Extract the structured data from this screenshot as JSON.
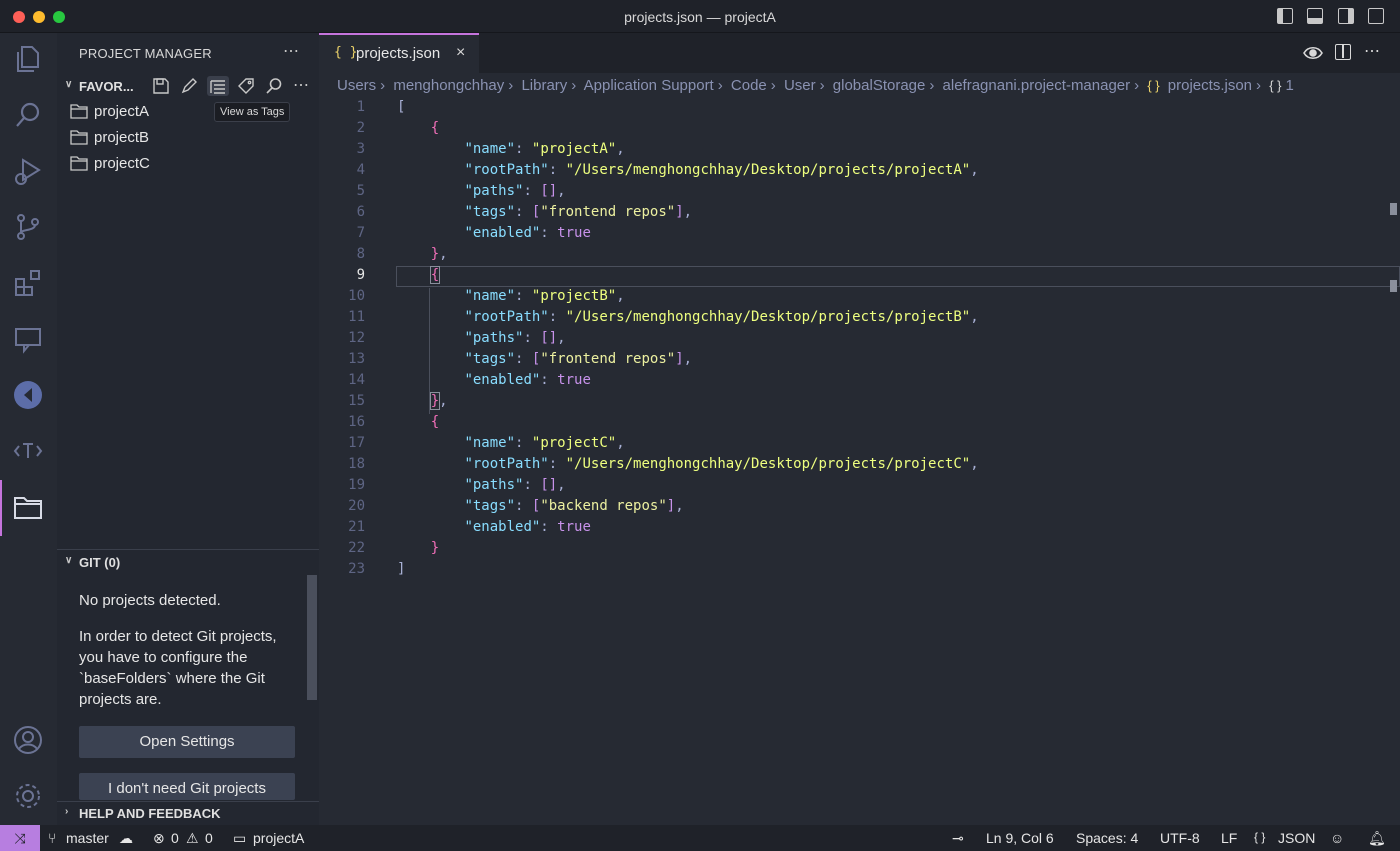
{
  "window": {
    "title": "projects.json — projectA"
  },
  "sidebar": {
    "title": "PROJECT MANAGER",
    "favorites_label": "FAVOR...",
    "tooltip": "View as Tags",
    "projects": [
      {
        "name": "projectA"
      },
      {
        "name": "projectB"
      },
      {
        "name": "projectC"
      }
    ],
    "git_label": "GIT (0)",
    "git_message_1": "No projects detected.",
    "git_message_2": "In order to detect Git projects, you have to configure the `baseFolders` where the Git projects are.",
    "open_settings": "Open Settings",
    "no_git": "I don't need Git projects",
    "help_label": "HELP AND FEEDBACK"
  },
  "editor": {
    "tab_label": "projects.json",
    "tab_icon": "{ }",
    "breadcrumb": [
      "Users",
      "menghongchhay",
      "Library",
      "Application Support",
      "Code",
      "User",
      "globalStorage",
      "alefragnani.project-manager",
      "projects.json",
      "1"
    ],
    "line_numbers": [
      "1",
      "2",
      "3",
      "4",
      "5",
      "6",
      "7",
      "8",
      "9",
      "10",
      "11",
      "12",
      "13",
      "14",
      "15",
      "16",
      "17",
      "18",
      "19",
      "20",
      "21",
      "22",
      "23"
    ],
    "projects": [
      {
        "name": "projectA",
        "rootPath": "/Users/menghongchhay/Desktop/projects/projectA",
        "tag": "frontend repos",
        "enabled": "true"
      },
      {
        "name": "projectB",
        "rootPath": "/Users/menghongchhay/Desktop/projects/projectB",
        "tag": "frontend repos",
        "enabled": "true"
      },
      {
        "name": "projectC",
        "rootPath": "/Users/menghongchhay/Desktop/projects/projectC",
        "tag": "backend repos",
        "enabled": "true"
      }
    ],
    "keys": {
      "name": "\"name\"",
      "rootPath": "\"rootPath\"",
      "paths": "\"paths\"",
      "tags": "\"tags\"",
      "enabled": "\"enabled\""
    }
  },
  "statusbar": {
    "branch": "master",
    "errors": "0",
    "warnings": "0",
    "project": "projectA",
    "cursor": "Ln 9, Col 6",
    "spaces": "Spaces: 4",
    "encoding": "UTF-8",
    "eol": "LF",
    "language": "JSON"
  },
  "colors": {
    "accent": "#c574dd",
    "string": "#eeff7f",
    "key": "#89ddff",
    "keyword": "#c792ea"
  }
}
